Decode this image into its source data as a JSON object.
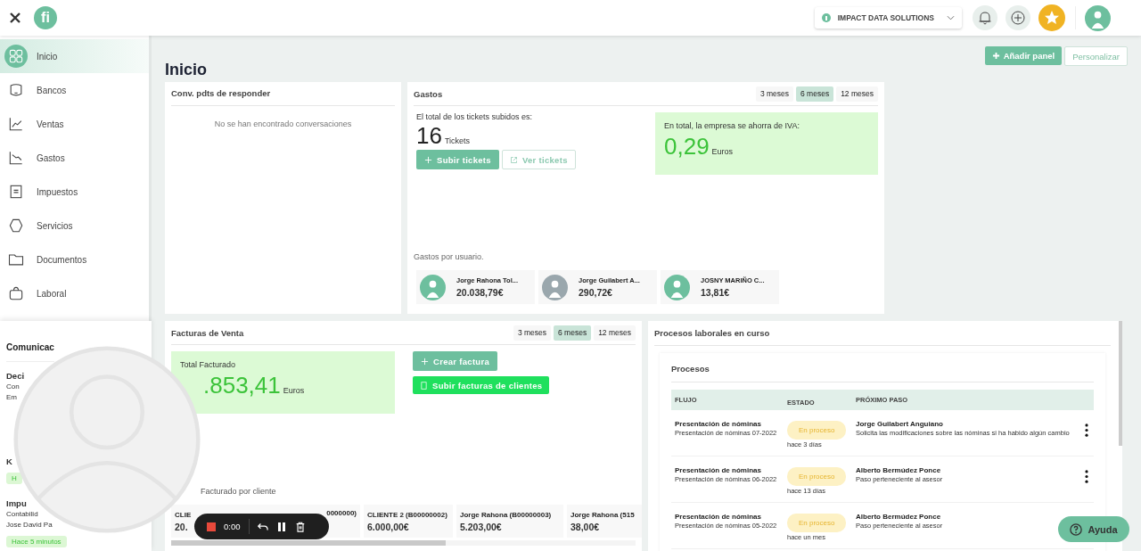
{
  "topbar": {
    "logo": "fi",
    "company": "IMPACT DATA SOLUTIONS"
  },
  "sidebar": {
    "items": [
      {
        "label": "Inicio",
        "selected": true
      },
      {
        "label": "Bancos",
        "selected": false
      },
      {
        "label": "Ventas",
        "selected": false
      },
      {
        "label": "Gastos",
        "selected": false
      },
      {
        "label": "Impuestos",
        "selected": false
      },
      {
        "label": "Servicios",
        "selected": false
      },
      {
        "label": "Documentos",
        "selected": false
      },
      {
        "label": "Laboral",
        "selected": false
      }
    ]
  },
  "sheet": {
    "title": "Comunicac",
    "items": [
      {
        "lines": [
          "Deci",
          "Con",
          "Em"
        ]
      },
      {
        "lines": [
          "K"
        ],
        "tag": "H"
      },
      {
        "lines": [
          "Impu",
          "Contabilid",
          "Jose David Pa"
        ],
        "tag": "Hace 5 minutos"
      }
    ]
  },
  "page_title": "Inicio",
  "actions": {
    "add": "Añadir panel",
    "customize": "Personalizar"
  },
  "conversations": {
    "title": "Conv. pdts de responder",
    "empty": "No se han encontrado conversaciones"
  },
  "expenses": {
    "title": "Gastos",
    "periods": [
      {
        "label": "3 meses",
        "selected": false
      },
      {
        "label": "6 meses",
        "selected": true
      },
      {
        "label": "12 meses",
        "selected": false
      }
    ],
    "tickets_label": "El total de los tickets subidos es:",
    "tickets_count": "16",
    "tickets_unit": "Tickets",
    "upload": "Subir tickets",
    "view": "Ver tickets",
    "savings_label": "En total, la empresa se ahorra de IVA:",
    "savings_value": "0,29",
    "savings_unit": "Euros",
    "users_label": "Gastos por usuario.",
    "users": [
      {
        "name": "Jorge Rahona Tol...",
        "amount": "20.038,79€"
      },
      {
        "name": "Jorge Guilabert A...",
        "amount": "290,72€"
      },
      {
        "name": "JOSNY MARIÑO C...",
        "amount": "13,81€"
      }
    ]
  },
  "invoices": {
    "title": "Facturas de Venta",
    "periods": [
      {
        "label": "3 meses",
        "selected": false
      },
      {
        "label": "6 meses",
        "selected": true
      },
      {
        "label": "12 meses",
        "selected": false
      }
    ],
    "total_label": "Total Facturado",
    "total_value": ".853,41",
    "total_unit": "Euros",
    "create": "Crear factura",
    "upload": "Subir facturas de clientes",
    "clients_label": "Facturado por cliente",
    "clients": [
      {
        "name": "CLIE",
        "amount": "20."
      },
      {
        "name": "0000000)"
      },
      {
        "name": "CLIENTE 2 (B00000002)",
        "amount": "6.000,00€"
      },
      {
        "name": "Jorge Rahona (B00000003)",
        "amount": "5.203,00€"
      },
      {
        "name": "Jorge Rahona (515",
        "amount": "38,00€"
      }
    ]
  },
  "processes": {
    "title": "Procesos laborales en curso",
    "inner_title": "Procesos",
    "columns": [
      "FLUJO",
      "ESTADO",
      "PRÓXIMO PASO"
    ],
    "rows": [
      {
        "flow": "Presentación de nóminas",
        "flow_sub": "Presentación de nóminas 07-2022",
        "status": "En proceso",
        "time": "hace 3 días",
        "next": "Jorge Guilabert Anguiano",
        "next_desc": "Solicita las modificaciones sobre las nóminas si ha habido algún cambio"
      },
      {
        "flow": "Presentación de nóminas",
        "flow_sub": "Presentación de nóminas 06-2022",
        "status": "En proceso",
        "time": "hace 13 días",
        "next": "Alberto Bermúdez Ponce",
        "next_desc": "Paso perteneciente al asesor"
      },
      {
        "flow": "Presentación de nóminas",
        "flow_sub": "Presentación de nóminas 05-2022",
        "status": "En proceso",
        "time": "hace un mes",
        "next": "Alberto Bermúdez Ponce",
        "next_desc": "Paso perteneciente al asesor"
      }
    ]
  },
  "recorder": {
    "time": "0:00"
  },
  "help": "Ayuda"
}
